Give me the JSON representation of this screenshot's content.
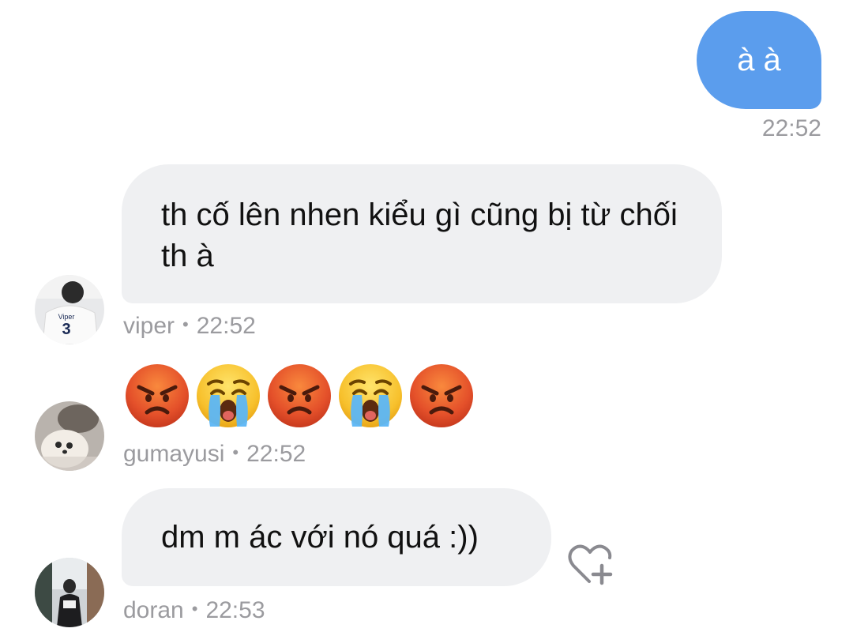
{
  "messages": [
    {
      "direction": "outgoing",
      "text": "à à",
      "time": "22:52",
      "bubble_color": "#5b9ded"
    },
    {
      "direction": "incoming",
      "text": "th cố lên nhen kiểu gì cũng bị từ chối th à",
      "sender": "viper",
      "time": "22:52",
      "avatar_jersey_name": "Viper",
      "avatar_jersey_number": "3",
      "bubble_color": "#eff0f2"
    },
    {
      "direction": "incoming",
      "type": "emoji",
      "emojis": [
        "angry-face",
        "loudly-crying-face",
        "angry-face",
        "loudly-crying-face",
        "angry-face"
      ],
      "sender": "gumayusi",
      "time": "22:52"
    },
    {
      "direction": "incoming",
      "text": "dm m ác với nó quá :))",
      "sender": "doran",
      "time": "22:53",
      "reaction_icon": "heart-plus-icon"
    }
  ],
  "meta_separator": "•",
  "colors": {
    "outgoing_bubble": "#5b9ded",
    "incoming_bubble": "#eff0f2",
    "meta_text": "#9b9b9f"
  }
}
